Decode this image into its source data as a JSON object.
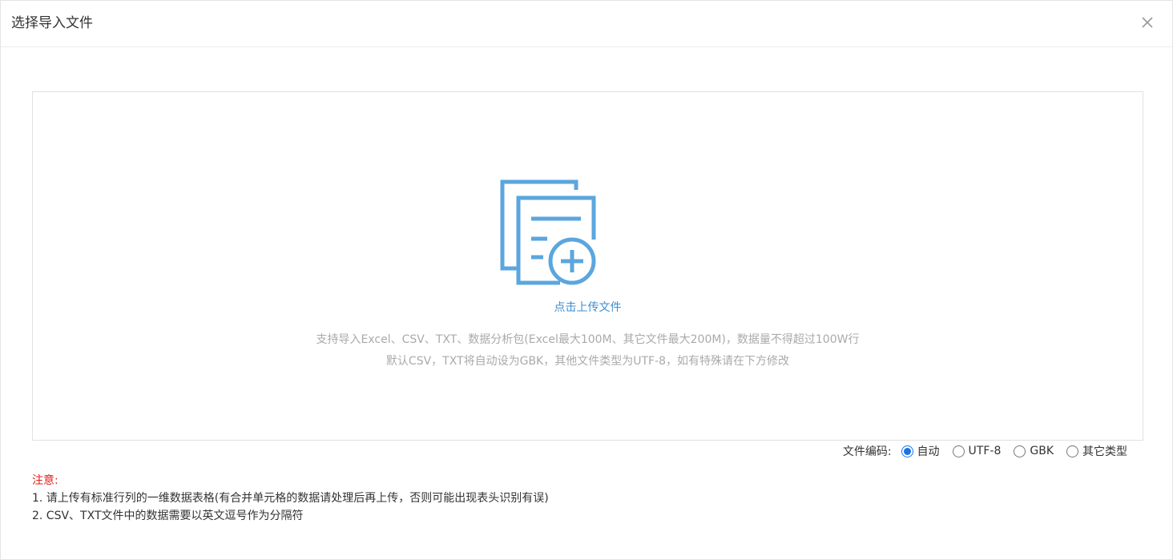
{
  "dialog": {
    "title": "选择导入文件",
    "close_icon": "close-icon"
  },
  "upload": {
    "icon": "add-file-icon",
    "label": "点击上传文件",
    "hint_line1": "支持导入Excel、CSV、TXT、数据分析包(Excel最大100M、其它文件最大200M)，数据量不得超过100W行",
    "hint_line2": "默认CSV，TXT将自动设为GBK，其他文件类型为UTF-8，如有特殊请在下方修改"
  },
  "encoding": {
    "label": "文件编码:",
    "selected": "自动",
    "options": [
      "自动",
      "UTF-8",
      "GBK",
      "其它类型"
    ]
  },
  "notes": {
    "title": "注意:",
    "lines": [
      "1. 请上传有标准行列的一维数据表格(有合并单元格的数据请处理后再上传，否则可能出现表头识别有误)",
      "2. CSV、TXT文件中的数据需要以英文逗号作为分隔符"
    ]
  },
  "colors": {
    "accent": "#3d8fd1",
    "icon": "#5ba6de",
    "radio_checked": "#1a73e8",
    "warning": "#e02020",
    "hint": "#aaaaaa"
  }
}
